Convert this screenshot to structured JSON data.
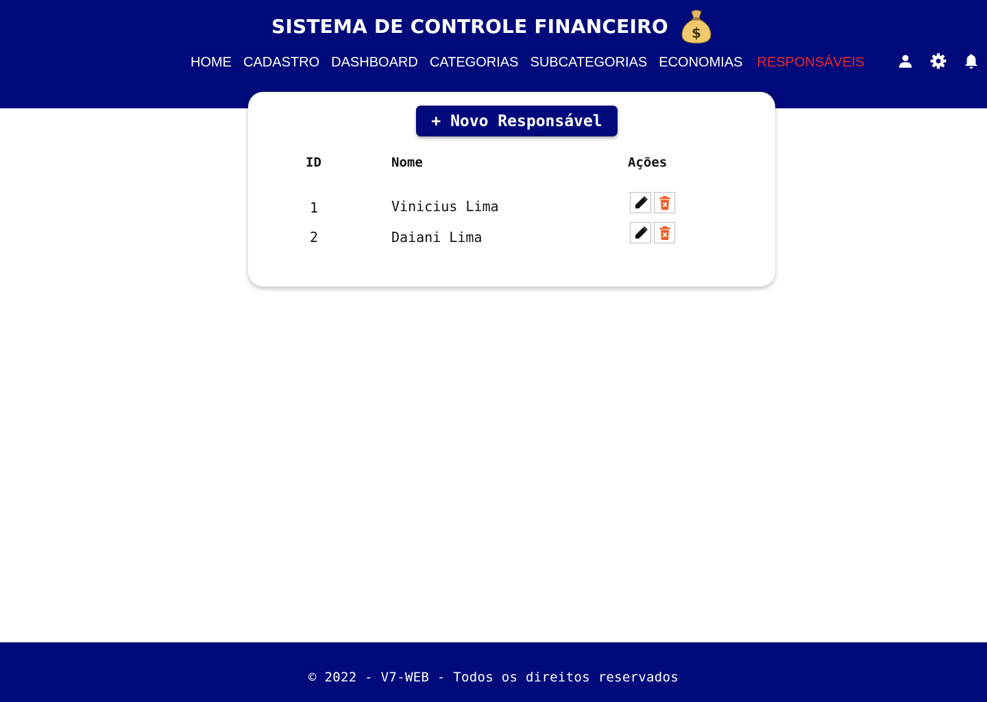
{
  "header": {
    "title": "SISTEMA DE CONTROLE FINANCEIRO",
    "logo_icon": "money-bag-icon",
    "nav": [
      {
        "label": "HOME",
        "active": false
      },
      {
        "label": "CADASTRO",
        "active": false
      },
      {
        "label": "DASHBOARD",
        "active": false
      },
      {
        "label": "CATEGORIAS",
        "active": false
      },
      {
        "label": "SUBCATEGORIAS",
        "active": false
      },
      {
        "label": "ECONOMIAS",
        "active": false
      },
      {
        "label": "RESPONSÁVEIS",
        "active": true
      }
    ],
    "icons": [
      "user-icon",
      "gear-icon",
      "bell-icon"
    ]
  },
  "main": {
    "new_button_label": "+ Novo Responsável",
    "columns": [
      "ID",
      "Nome",
      "Ações"
    ],
    "rows": [
      {
        "id": "1",
        "nome": "Vinicius Lima"
      },
      {
        "id": "2",
        "nome": "Daiani Lima"
      }
    ],
    "row_actions": [
      "edit-pencil-icon",
      "delete-trash-icon"
    ]
  },
  "footer": {
    "text": "© 2022 - V7-WEB - Todos os direitos reservados"
  },
  "colors": {
    "primary": "#000a7a",
    "active_nav": "#e8262c",
    "delete": "#f15a24"
  }
}
